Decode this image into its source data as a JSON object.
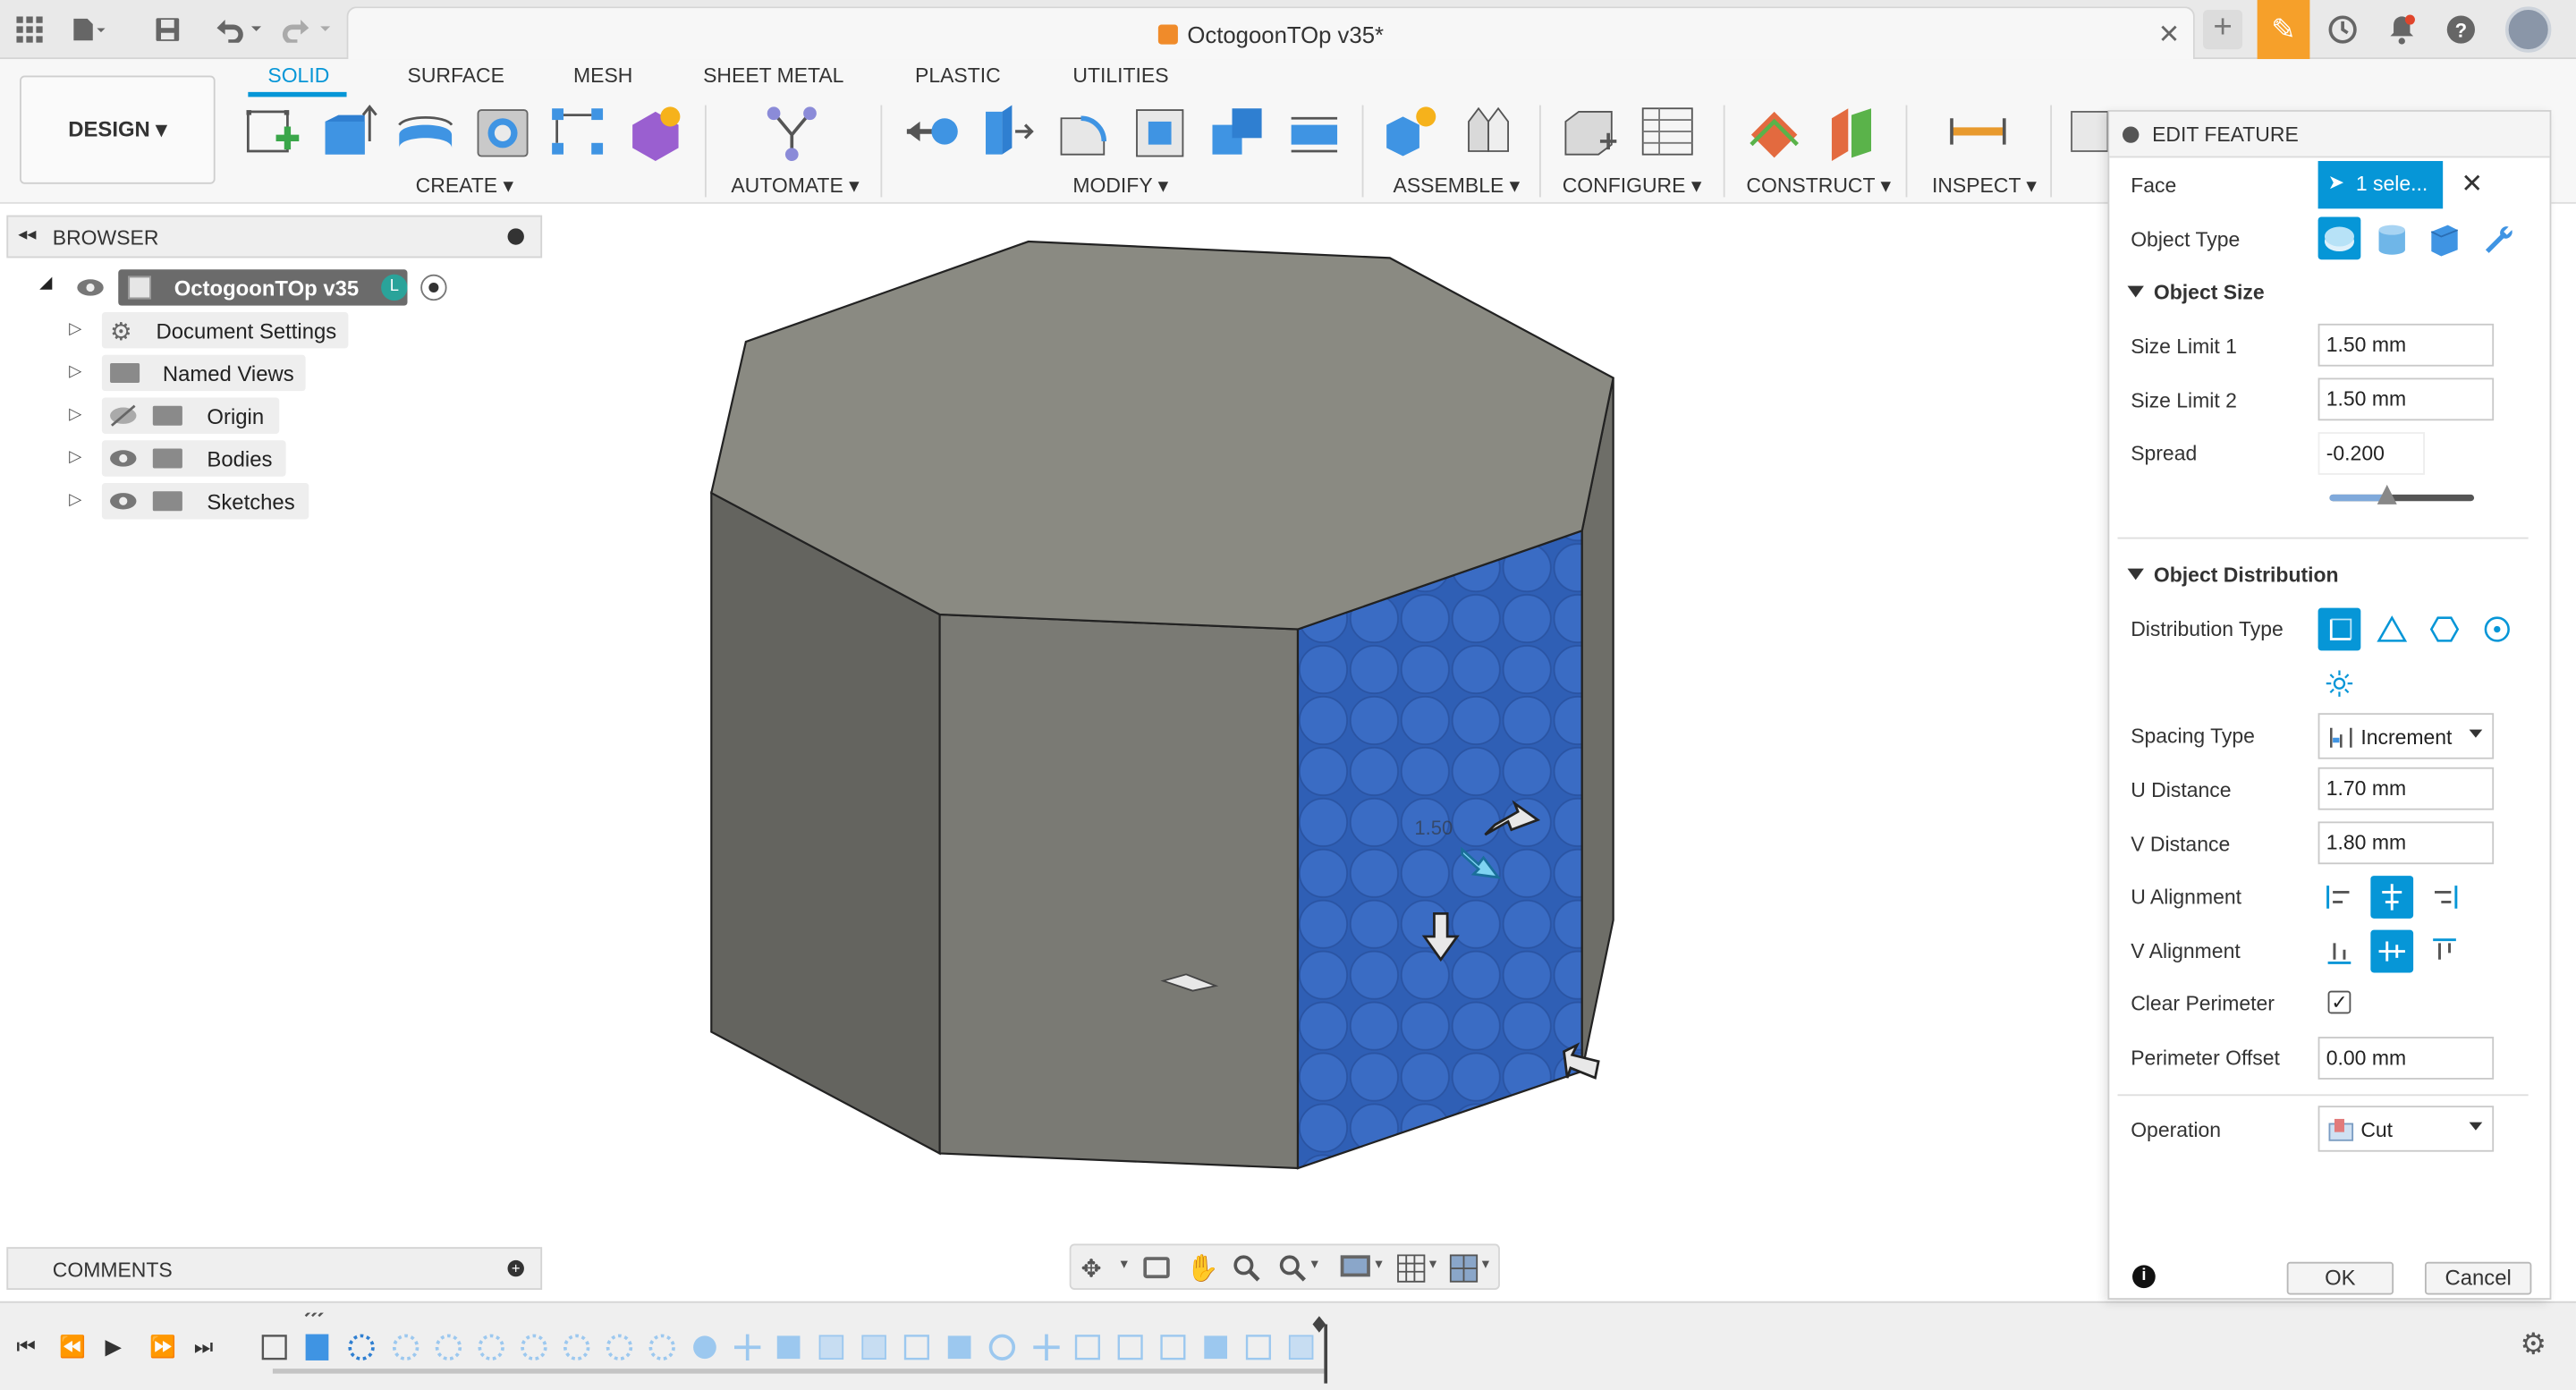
{
  "window": {
    "doc_title": "OctogoonTOp v35*"
  },
  "workspace": {
    "mode_label": "DESIGN ▾"
  },
  "tabs": [
    "SOLID",
    "SURFACE",
    "MESH",
    "SHEET METAL",
    "PLASTIC",
    "UTILITIES"
  ],
  "tool_groups": [
    "CREATE ▾",
    "AUTOMATE ▾",
    "MODIFY ▾",
    "ASSEMBLE ▾",
    "CONFIGURE ▾",
    "CONSTRUCT ▾",
    "INSPECT ▾"
  ],
  "browser": {
    "header": "BROWSER",
    "root": "OctogoonTOp v35",
    "items": [
      "Document Settings",
      "Named Views",
      "Origin",
      "Bodies",
      "Sketches"
    ]
  },
  "comments": {
    "label": "COMMENTS"
  },
  "viewport": {
    "dimension_label": "1.50"
  },
  "panel": {
    "title": "EDIT FEATURE",
    "face_label": "Face",
    "face_value": "1 sele...",
    "object_type_label": "Object Type",
    "object_size_section": "Object Size",
    "size_limit_1_label": "Size Limit 1",
    "size_limit_1": "1.50 mm",
    "size_limit_2_label": "Size Limit 2",
    "size_limit_2": "1.50 mm",
    "spread_label": "Spread",
    "spread": "-0.200",
    "spread_slider_fraction": 0.4,
    "distribution_section": "Object Distribution",
    "distribution_type_label": "Distribution Type",
    "spacing_type_label": "Spacing Type",
    "spacing_type": "Increment",
    "u_distance_label": "U Distance",
    "u_distance": "1.70 mm",
    "v_distance_label": "V Distance",
    "v_distance": "1.80 mm",
    "u_alignment_label": "U Alignment",
    "v_alignment_label": "V Alignment",
    "clear_perimeter_label": "Clear Perimeter",
    "clear_perimeter_checked": true,
    "perimeter_offset_label": "Perimeter Offset",
    "perimeter_offset": "0.00 mm",
    "operation_label": "Operation",
    "operation": "Cut",
    "ok": "OK",
    "cancel": "Cancel"
  },
  "colors": {
    "accent": "#0696d7",
    "selected_face": "#2f5fb5",
    "body_top": "#8a8a82",
    "body_side": "#75756f",
    "body_dark": "#63635e"
  }
}
